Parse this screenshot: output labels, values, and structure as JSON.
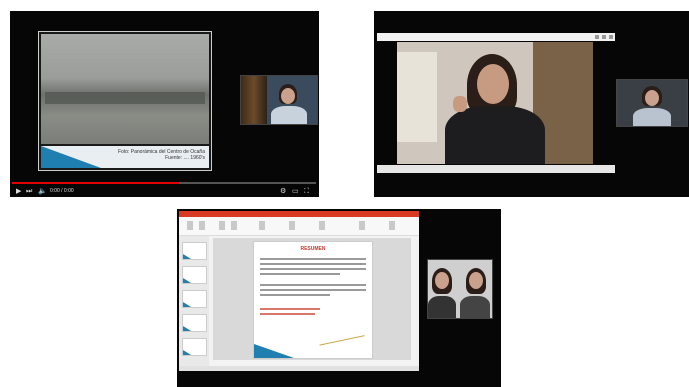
{
  "panel_video": {
    "slide_caption_line1": "Foto: Panorámica del Centro de Ocaña",
    "slide_caption_line2": "Fuente: .... 1960's",
    "time": "0:00 / 0:00",
    "progress_fraction": 0.55,
    "accent_color": "#e00000"
  },
  "panel_meeting": {
    "window_icons": [
      "minimize-icon",
      "maximize-icon",
      "close-icon"
    ]
  },
  "panel_presentation": {
    "slide_title": "RESUMEN",
    "accent_color": "#d83b21"
  }
}
